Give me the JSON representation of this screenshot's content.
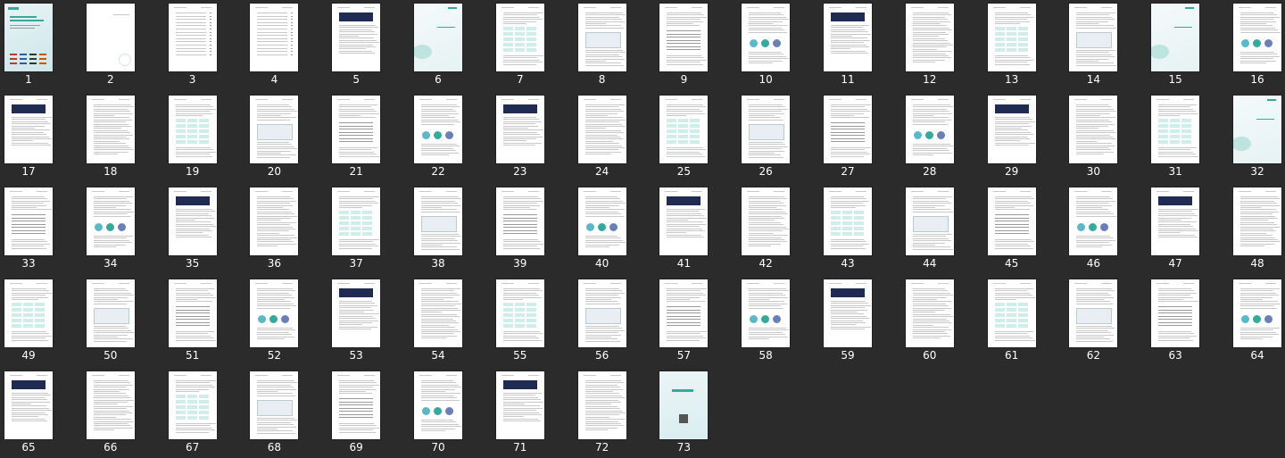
{
  "pages": [
    "1",
    "2",
    "3",
    "4",
    "5",
    "6",
    "7",
    "8",
    "9",
    "10",
    "11",
    "12",
    "13",
    "14",
    "15",
    "16",
    "17",
    "18",
    "19",
    "20",
    "21",
    "22",
    "23",
    "24",
    "25",
    "26",
    "27",
    "28",
    "29",
    "30",
    "31",
    "32",
    "33",
    "34",
    "35",
    "36",
    "37",
    "38",
    "39",
    "40",
    "41",
    "42",
    "43",
    "44",
    "45",
    "46",
    "47",
    "48",
    "49",
    "50",
    "51",
    "52",
    "53",
    "54",
    "55",
    "56",
    "57",
    "58",
    "59",
    "60",
    "61",
    "62",
    "63",
    "64",
    "65",
    "66",
    "67",
    "68",
    "69",
    "70",
    "71",
    "72",
    "73"
  ],
  "page_types": {
    "1": "cover",
    "2": "blank-mark",
    "3": "toc",
    "4": "toc",
    "5": "text",
    "6": "section",
    "15": "section",
    "32": "section",
    "73": "back"
  }
}
